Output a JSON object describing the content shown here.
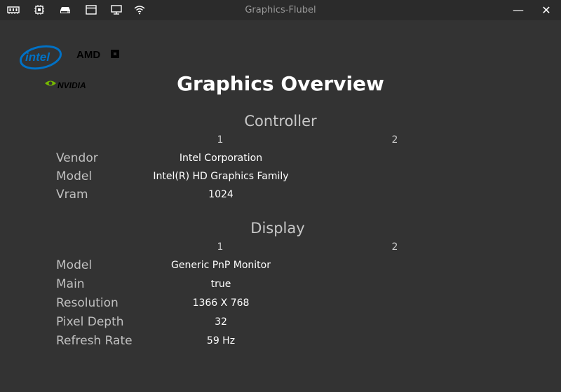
{
  "window": {
    "title": "Graphics-Flubel",
    "minimize_label": "—",
    "close_label": "✕"
  },
  "toolbar_icons": [
    "memory-icon",
    "cpu-icon",
    "disk-icon",
    "window-icon",
    "monitor-icon",
    "wifi-icon"
  ],
  "logos": {
    "intel": "intel",
    "amd": "AMD",
    "nvidia": "NVIDIA"
  },
  "page": {
    "title": "Graphics Overview"
  },
  "controller": {
    "title": "Controller",
    "columns": [
      "1",
      "2"
    ],
    "rows": [
      {
        "label": "Vendor",
        "value": "Intel Corporation"
      },
      {
        "label": "Model",
        "value": "Intel(R) HD Graphics Family"
      },
      {
        "label": "Vram",
        "value": "1024"
      }
    ]
  },
  "display": {
    "title": "Display",
    "columns": [
      "1",
      "2"
    ],
    "rows": [
      {
        "label": "Model",
        "value": "Generic PnP Monitor"
      },
      {
        "label": "Main",
        "value": "true"
      },
      {
        "label": "Resolution",
        "value": "1366 X 768"
      },
      {
        "label": "Pixel Depth",
        "value": "32"
      },
      {
        "label": "Refresh Rate",
        "value": "59 Hz"
      }
    ]
  },
  "colors": {
    "background": "#333333",
    "titlebar": "#2b2b2b",
    "nvidia_green": "#76b900",
    "intel_blue": "#0071c5"
  }
}
